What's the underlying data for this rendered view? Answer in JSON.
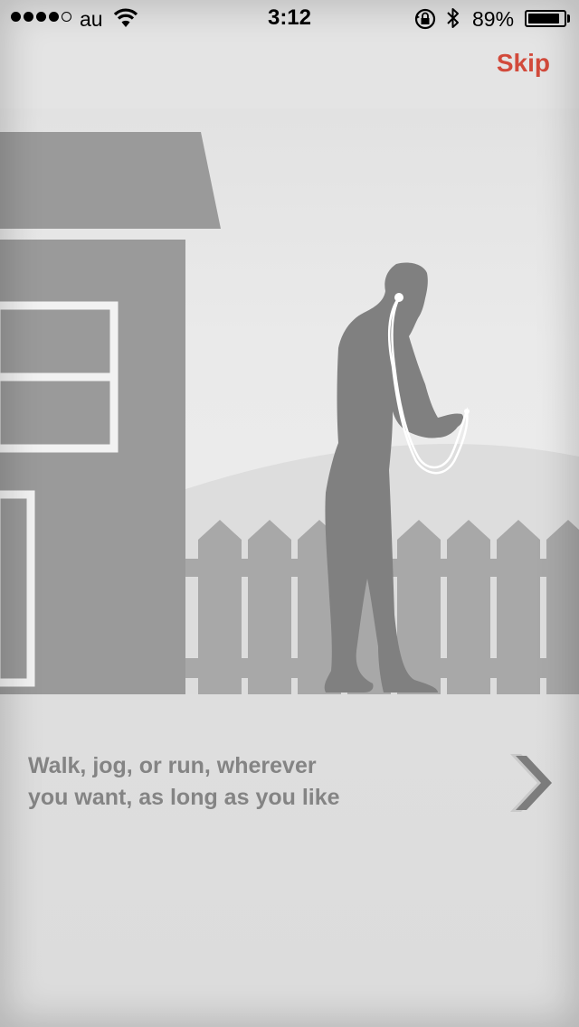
{
  "status_bar": {
    "carrier": "au",
    "time": "3:12",
    "battery_percent": "89%",
    "battery_level": 0.89,
    "signal_bars_filled": 4,
    "signal_bars_total": 5
  },
  "header": {
    "skip_label": "Skip",
    "skip_color": "#d24a3b"
  },
  "onboarding": {
    "caption_line1": "Walk, jog, or run, wherever",
    "caption_line2": "you want, as long as you like",
    "next_icon": "chevron-right-icon"
  },
  "colors": {
    "house": "#9a9a9a",
    "fence": "#a8a8a8",
    "figure": "#808080",
    "background": "#ececec"
  }
}
